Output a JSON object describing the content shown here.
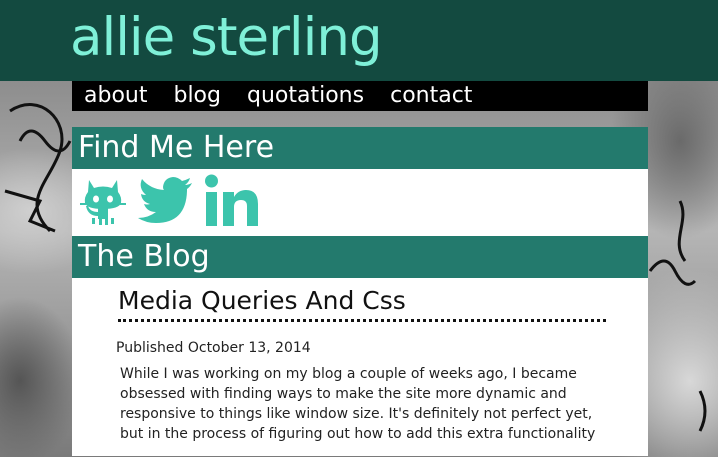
{
  "site": {
    "title": "allie sterling"
  },
  "nav": {
    "items": [
      "about",
      "blog",
      "quotations",
      "contact"
    ]
  },
  "find_me": {
    "heading": "Find Me Here",
    "icons": [
      "github-icon",
      "twitter-icon",
      "linkedin-icon"
    ]
  },
  "blog": {
    "heading": "The Blog",
    "post": {
      "title": "Media Queries And Css",
      "date": "Published October 13, 2014",
      "excerpt": "While I was working on my blog a couple of weeks ago, I became obsessed with finding ways to make the site more dynamic and responsive to things like window size. It's definitely not perfect yet, but in the process of figuring out how to add this extra functionality"
    }
  },
  "colors": {
    "header_bg": "#134a40",
    "title_text": "#7ff0d8",
    "section_bar": "#237a6d",
    "icon_teal": "#3cc4ac",
    "nav_bg": "#000000"
  }
}
